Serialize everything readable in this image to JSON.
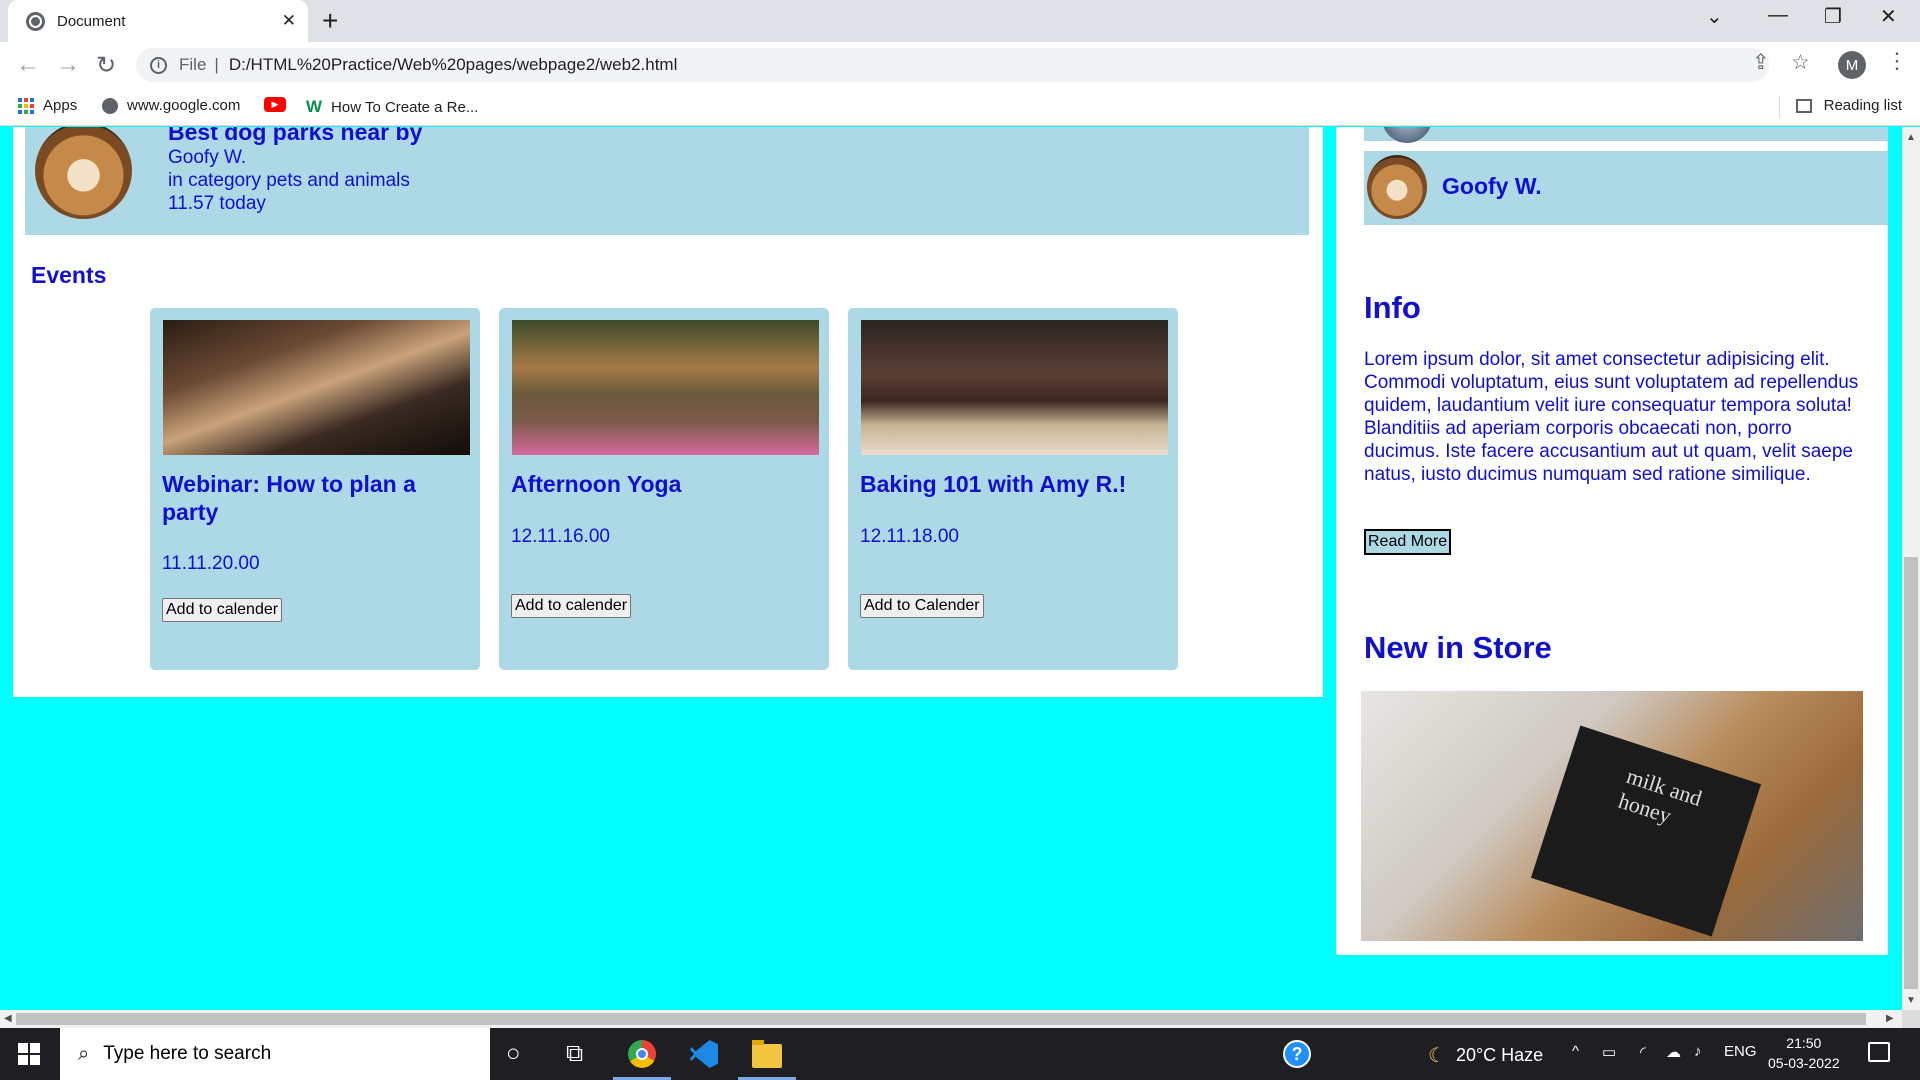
{
  "browser": {
    "tab_title": "Document",
    "address_scheme": "File",
    "address_url": "D:/HTML%20Practice/Web%20pages/webpage2/web2.html",
    "profile_initial": "M",
    "bookmarks": [
      {
        "label": "Apps",
        "icon": "apps-icon"
      },
      {
        "label": "www.google.com",
        "icon": "globe-icon"
      },
      {
        "label": "",
        "icon": "youtube-icon"
      },
      {
        "label": "How To Create a Re...",
        "icon": "w-icon"
      }
    ],
    "reading_list": "Reading list"
  },
  "post": {
    "title": "Best dog parks near by",
    "author": "Goofy W.",
    "category": "in category pets and animals",
    "time": "11.57 today"
  },
  "events": {
    "heading": "Events",
    "cards": [
      {
        "title": "Webinar: How to plan a party",
        "date": "11.11.20.00",
        "button": "Add to calender",
        "image": "party-photo"
      },
      {
        "title": "Afternoon Yoga",
        "date": "12.11.16.00",
        "button": "Add to calender",
        "image": "yoga-photo"
      },
      {
        "title": "Baking 101 with Amy R.!",
        "date": "12.11.18.00",
        "button": "Add to Calender",
        "image": "brownie-photo"
      }
    ]
  },
  "sidebar": {
    "user_name": "Goofy W.",
    "info_heading": "Info",
    "info_text": "Lorem ipsum dolor, sit amet consectetur adipisicing elit. Commodi voluptatum, eius sunt voluptatem ad repellendus quidem, laudantium velit iure consequatur tempora soluta! Blanditiis ad aperiam corporis obcaecati non, porro ducimus. Iste facere accusantium aut ut quam, velit saepe natus, iusto ducimus numquam sed ratione similique.",
    "read_more": "Read More",
    "store_heading": "New in Store",
    "store_book_text": "milk and honey"
  },
  "taskbar": {
    "search_placeholder": "Type here to search",
    "weather": "20°C  Haze",
    "language": "ENG",
    "time": "21:50",
    "date": "05-03-2022"
  },
  "colors": {
    "page_bg": "#00ffff",
    "card_bg": "#add8e6",
    "text_blue": "#1010d0"
  }
}
